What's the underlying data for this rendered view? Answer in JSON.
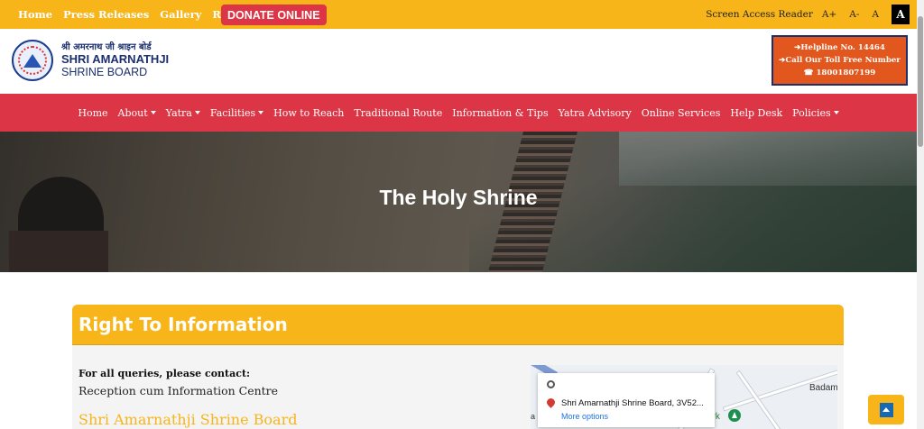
{
  "topbar": {
    "links": [
      "Home",
      "Press Releases",
      "Gallery",
      "RTI"
    ],
    "donate_label": "DONATE ONLINE",
    "access_label": "Screen Access Reader",
    "font_increase": "A+",
    "font_decrease": "A-",
    "font_normal": "A",
    "contrast": "A"
  },
  "header": {
    "logo_hindi": "श्री अमरनाथ जी श्राइन बोर्ड",
    "logo_line1": "SHRI AMARNATHJI",
    "logo_line2": "SHRINE BOARD",
    "helpline_line1": "➔Helpline No. 14464",
    "helpline_line2": "➔Call Our Toll Free Number",
    "helpline_line3": "☎ 18001807199"
  },
  "nav": {
    "items": [
      {
        "label": "Home",
        "dropdown": false
      },
      {
        "label": "About",
        "dropdown": true
      },
      {
        "label": "Yatra",
        "dropdown": true
      },
      {
        "label": "Facilities",
        "dropdown": true
      },
      {
        "label": "How to Reach",
        "dropdown": false
      },
      {
        "label": "Traditional Route",
        "dropdown": false
      },
      {
        "label": "Information & Tips",
        "dropdown": false
      },
      {
        "label": "Yatra Advisory",
        "dropdown": false
      },
      {
        "label": "Online Services",
        "dropdown": false
      },
      {
        "label": "Help Desk",
        "dropdown": false
      },
      {
        "label": "Policies",
        "dropdown": true
      }
    ]
  },
  "hero": {
    "title": "The Holy Shrine"
  },
  "content": {
    "section_title": "Right To Information",
    "contact_label": "For all queries, please contact:",
    "centre": "Reception cum Information Centre",
    "board": "Shri Amarnathji Shrine Board"
  },
  "map": {
    "place_name": "Shri Amarnathji Shrine Board, 3V52...",
    "more_options": "More options",
    "label_badam": "Badam",
    "label_park": "ark",
    "label_a": "a"
  },
  "colors": {
    "accent_yellow": "#f7b519",
    "nav_red": "#dc3545",
    "helpline_orange": "#e2571e",
    "brand_navy": "#1b2f6e"
  }
}
